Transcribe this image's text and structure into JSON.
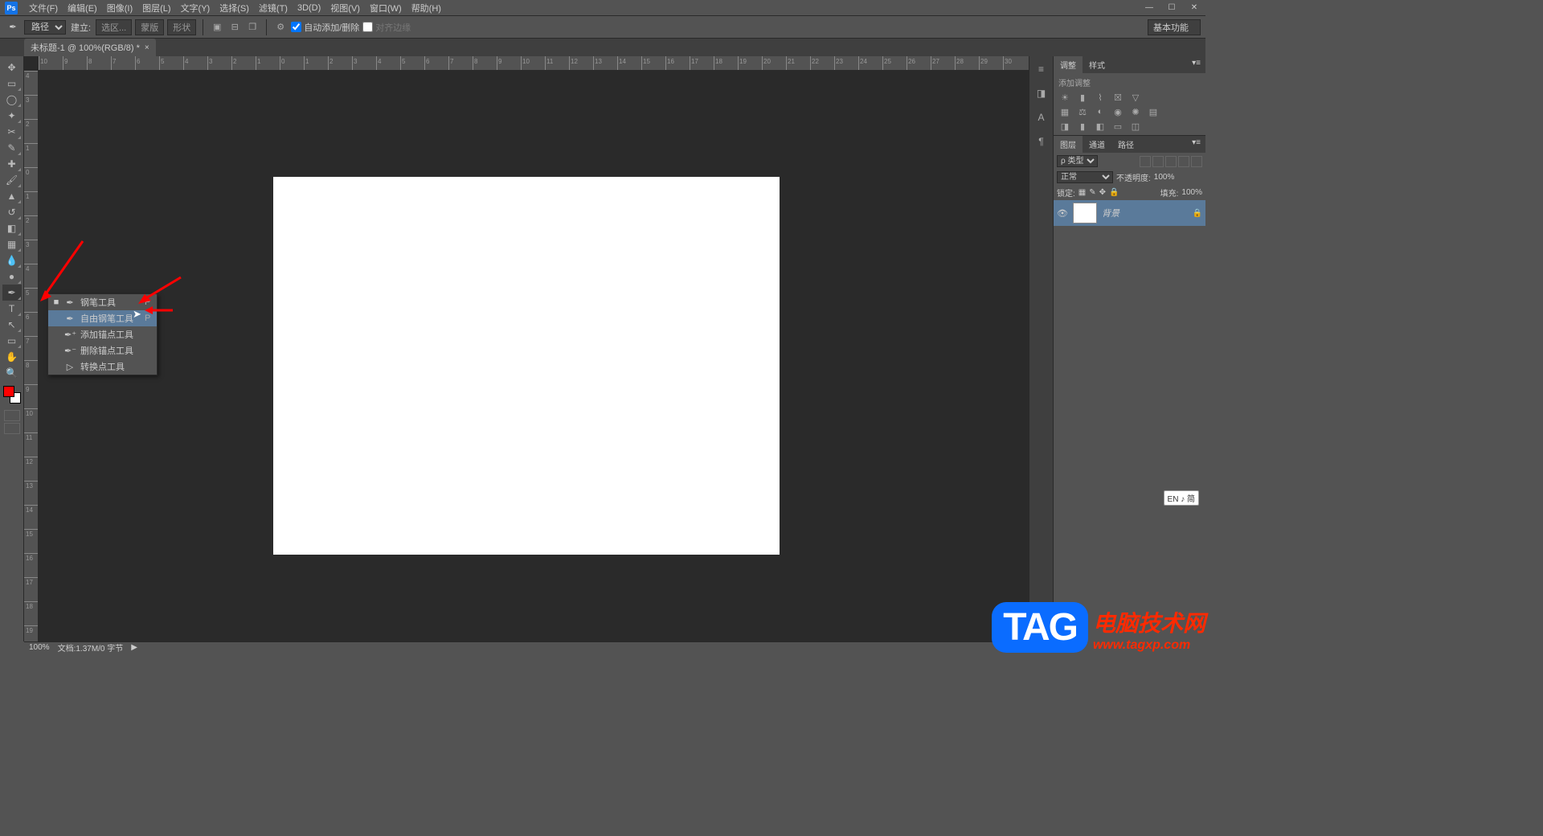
{
  "menubar": {
    "items": [
      "文件(F)",
      "编辑(E)",
      "图像(I)",
      "图层(L)",
      "文字(Y)",
      "选择(S)",
      "滤镜(T)",
      "3D(D)",
      "视图(V)",
      "窗口(W)",
      "帮助(H)"
    ]
  },
  "optionsbar": {
    "mode_label": "路径",
    "build_label": "建立:",
    "btn_selection": "选区...",
    "btn_mask": "蒙版",
    "btn_shape": "形状",
    "auto_add_label": "自动添加/删除",
    "align_edges_label": "对齐边缘",
    "workspace": "基本功能"
  },
  "doc_tab": {
    "title": "未标题-1 @ 100%(RGB/8) *",
    "close": "×"
  },
  "flyout": {
    "items": [
      {
        "icon": "✒",
        "label": "钢笔工具",
        "key": "P",
        "active": true
      },
      {
        "icon": "✒",
        "label": "自由钢笔工具",
        "key": "P",
        "highlight": true
      },
      {
        "icon": "✒⁺",
        "label": "添加锚点工具",
        "key": ""
      },
      {
        "icon": "✒⁻",
        "label": "删除锚点工具",
        "key": ""
      },
      {
        "icon": "▷",
        "label": "转换点工具",
        "key": ""
      }
    ]
  },
  "ruler_h": [
    "10",
    "9",
    "8",
    "7",
    "6",
    "5",
    "4",
    "3",
    "2",
    "1",
    "0",
    "1",
    "2",
    "3",
    "4",
    "5",
    "6",
    "7",
    "8",
    "9",
    "10",
    "11",
    "12",
    "13",
    "14",
    "15",
    "16",
    "17",
    "18",
    "19",
    "20",
    "21",
    "22",
    "23",
    "24",
    "25",
    "26",
    "27",
    "28",
    "29",
    "30"
  ],
  "ruler_v": [
    "4",
    "3",
    "2",
    "1",
    "0",
    "1",
    "2",
    "3",
    "4",
    "5",
    "6",
    "7",
    "8",
    "9",
    "10",
    "11",
    "12",
    "13",
    "14",
    "15",
    "16",
    "17",
    "18",
    "19"
  ],
  "panels": {
    "adjust_tab": "调整",
    "styles_tab": "样式",
    "adjust_title": "添加调整",
    "layers_tab": "图层",
    "channels_tab": "通道",
    "paths_tab": "路径",
    "kind_label": "ρ 类型",
    "blend_mode": "正常",
    "opacity_label": "不透明度:",
    "opacity_value": "100%",
    "lock_label": "锁定:",
    "fill_label": "填充:",
    "fill_value": "100%",
    "layer_name": "背景"
  },
  "statusbar": {
    "zoom": "100%",
    "doc_info": "文档:1.37M/0 字节"
  },
  "ime": "EN ♪ 简",
  "watermark": {
    "badge": "TAG",
    "line1": "电脑技术网",
    "line2": "www.tagxp.com"
  }
}
